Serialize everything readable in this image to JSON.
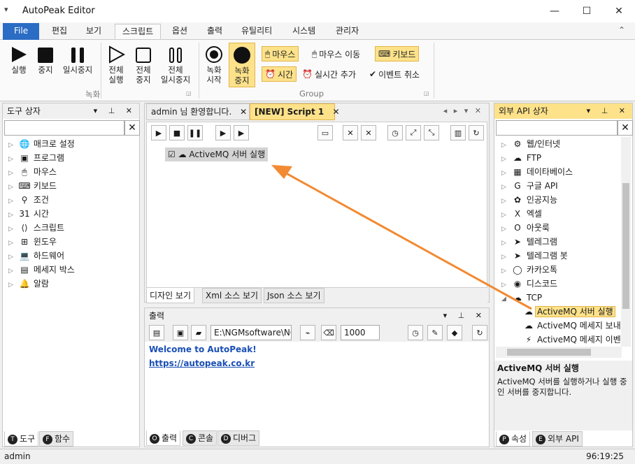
{
  "window": {
    "title": "AutoPeak Editor",
    "sysmenu": "▾",
    "minimize": "—",
    "maximize": "☐",
    "close": "✕"
  },
  "ribbon_tabs": [
    "File",
    "편집",
    "보기",
    "스크립트",
    "옵션",
    "출력",
    "유틸리티",
    "시스템",
    "관리자"
  ],
  "active_tab": "스크립트",
  "ribbon_collapse": "⌃",
  "ribbon": {
    "run": "실행",
    "stop": "중지",
    "pause": "일시중지",
    "run_all": "전체\n실행",
    "stop_all": "전체\n중지",
    "pause_all": "전체\n일시중지",
    "rec_start": "녹화\n시작",
    "rec_stop": "녹화\n중지",
    "group_record": "녹화",
    "mouse": "마우스",
    "mouse_move": "마우스 이동",
    "keyboard": "키보드",
    "time": "시간",
    "realtime_add": "실시간 추가",
    "event_cancel": "이벤트 취소",
    "group_group": "Group"
  },
  "tool_box": {
    "title": "도구 상자",
    "items": [
      {
        "icon": "globe-icon",
        "glyph": "🌐",
        "label": "매크로 설정"
      },
      {
        "icon": "program-icon",
        "glyph": "▣",
        "label": "프로그램"
      },
      {
        "icon": "mouse-icon",
        "glyph": "🖱",
        "label": "마우스"
      },
      {
        "icon": "keyboard-icon",
        "glyph": "⌨",
        "label": "키보드"
      },
      {
        "icon": "condition-icon",
        "glyph": "⚲",
        "label": "조건"
      },
      {
        "icon": "calendar-icon",
        "glyph": "31",
        "label": "시간"
      },
      {
        "icon": "script-icon",
        "glyph": "⟨⟩",
        "label": "스크립트"
      },
      {
        "icon": "windows-icon",
        "glyph": "⊞",
        "label": "윈도우"
      },
      {
        "icon": "laptop-icon",
        "glyph": "💻",
        "label": "하드웨어"
      },
      {
        "icon": "message-icon",
        "glyph": "▤",
        "label": "메세지 박스"
      },
      {
        "icon": "bell-icon",
        "glyph": "🔔",
        "label": "알람"
      }
    ],
    "tabs": [
      {
        "badge": "T",
        "label": "도구"
      },
      {
        "badge": "F",
        "label": "함수"
      }
    ]
  },
  "doc_tabs": [
    {
      "label": "admin 님 환영합니다.",
      "close": "✕"
    },
    {
      "label": "[NEW] Script 1",
      "close": "✕"
    }
  ],
  "doc_ctrls": "◂ ▸ ▾ ✕",
  "script_nodes": [
    {
      "checked": "☑",
      "icon": "cloud-icon",
      "label": "ActiveMQ 서버 실행"
    }
  ],
  "view_tabs": [
    "디자인 보기",
    "Xml 소스 보기",
    "Json 소스 보기"
  ],
  "output": {
    "title": "출력",
    "path": "E:\\NGMsoftware\\NG",
    "size": "1000",
    "lines": [
      "Welcome to AutoPeak!",
      "https://autopeak.co.kr"
    ],
    "tabs": [
      {
        "badge": "O",
        "label": "출력"
      },
      {
        "badge": "C",
        "label": "콘솔"
      },
      {
        "badge": "D",
        "label": "디버그"
      }
    ]
  },
  "api_box": {
    "title": "외부 API 상자",
    "items": [
      {
        "icon": "web-icon",
        "glyph": "⚙",
        "label": "웹/인터넷",
        "expanded": false
      },
      {
        "icon": "ftp-icon",
        "glyph": "☁",
        "label": "FTP",
        "expanded": false
      },
      {
        "icon": "database-icon",
        "glyph": "▦",
        "label": "데이타베이스",
        "expanded": false
      },
      {
        "icon": "google-icon",
        "glyph": "G",
        "label": "구글 API",
        "expanded": false
      },
      {
        "icon": "ai-icon",
        "glyph": "✿",
        "label": "인공지능",
        "expanded": false
      },
      {
        "icon": "excel-icon",
        "glyph": "X",
        "label": "엑셀",
        "expanded": false
      },
      {
        "icon": "outlook-icon",
        "glyph": "O",
        "label": "아웃룩",
        "expanded": false
      },
      {
        "icon": "telegram-icon",
        "glyph": "➤",
        "label": "텔레그램",
        "expanded": false
      },
      {
        "icon": "telegram-bot-icon",
        "glyph": "➤",
        "label": "텔레그램 봇",
        "expanded": false
      },
      {
        "icon": "kakao-icon",
        "glyph": "◯",
        "label": "카카오톡",
        "expanded": false
      },
      {
        "icon": "discord-icon",
        "glyph": "◉",
        "label": "디스코드",
        "expanded": false
      },
      {
        "icon": "tcp-icon",
        "glyph": "☁",
        "label": "TCP",
        "expanded": true
      }
    ],
    "children": [
      {
        "icon": "cloud-icon",
        "glyph": "☁",
        "label": "ActiveMQ 서버 실행",
        "selected": true
      },
      {
        "icon": "cloud-icon",
        "glyph": "☁",
        "label": "ActiveMQ 메세지 보내기",
        "selected": false
      },
      {
        "icon": "bolt-icon",
        "glyph": "⚡",
        "label": "ActiveMQ 메세지 이벤트",
        "selected": false
      }
    ],
    "desc_title": "ActiveMQ 서버 실행",
    "desc_body": "ActiveMQ 서버를 실행하거나 실행 중인 서버를 중지합니다.",
    "tabs": [
      {
        "badge": "P",
        "label": "속성"
      },
      {
        "badge": "E",
        "label": "외부 API"
      }
    ]
  },
  "status": {
    "user": "admin",
    "time": "96:19:25"
  },
  "colors": {
    "accent": "#2b6cc4",
    "highlight": "#fde28a",
    "arrow": "#f28a33",
    "link": "#1a4fb5"
  }
}
